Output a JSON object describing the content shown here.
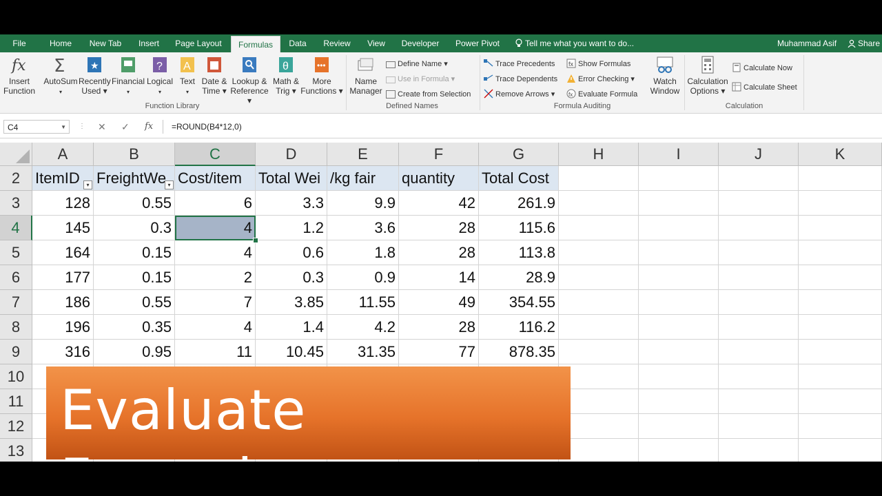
{
  "tabs": {
    "file": "File",
    "home": "Home",
    "new_tab": "New Tab",
    "insert": "Insert",
    "page_layout": "Page Layout",
    "formulas": "Formulas",
    "data": "Data",
    "review": "Review",
    "view": "View",
    "developer": "Developer",
    "power_pivot": "Power Pivot"
  },
  "tell_me": "Tell me what you want to do...",
  "user_name": "Muhammad Asif",
  "share": "Share",
  "ribbon": {
    "function_library": {
      "insert_function": [
        "Insert",
        "Function"
      ],
      "autosum": "AutoSum",
      "recently_used": [
        "Recently",
        "Used"
      ],
      "financial": "Financial",
      "logical": "Logical",
      "text": "Text",
      "date_time": [
        "Date &",
        "Time"
      ],
      "lookup": [
        "Lookup &",
        "Reference"
      ],
      "math": [
        "Math &",
        "Trig"
      ],
      "more": [
        "More",
        "Functions"
      ],
      "label": "Function Library"
    },
    "defined_names": {
      "name_manager": [
        "Name",
        "Manager"
      ],
      "define_name": "Define Name",
      "use_in_formula": "Use in Formula",
      "create_from_selection": "Create from Selection",
      "label": "Defined Names"
    },
    "formula_auditing": {
      "trace_precedents": "Trace Precedents",
      "trace_dependents": "Trace Dependents",
      "remove_arrows": "Remove Arrows",
      "show_formulas": "Show Formulas",
      "error_checking": "Error Checking",
      "evaluate_formula": "Evaluate Formula",
      "watch_window": [
        "Watch",
        "Window"
      ],
      "label": "Formula Auditing"
    },
    "calculation": {
      "calculation_options": [
        "Calculation",
        "Options"
      ],
      "calculate_now": "Calculate Now",
      "calculate_sheet": "Calculate Sheet",
      "label": "Calculation"
    }
  },
  "formula_bar": {
    "name_box": "C4",
    "formula": "=ROUND(B4*12,0)"
  },
  "columns": [
    "A",
    "B",
    "C",
    "D",
    "E",
    "F",
    "G",
    "H",
    "I",
    "J",
    "K"
  ],
  "rows": [
    "2",
    "3",
    "4",
    "5",
    "6",
    "7",
    "8",
    "9",
    "10",
    "11",
    "12",
    "13"
  ],
  "header_row": [
    "ItemID",
    "FreightWe",
    "Cost/item",
    "Total Wei",
    "/kg fair",
    "quantity",
    "Total Cost"
  ],
  "data_rows": [
    [
      "128",
      "0.55",
      "6",
      "3.3",
      "9.9",
      "42",
      "261.9"
    ],
    [
      "145",
      "0.3",
      "4",
      "1.2",
      "3.6",
      "28",
      "115.6"
    ],
    [
      "164",
      "0.15",
      "4",
      "0.6",
      "1.8",
      "28",
      "113.8"
    ],
    [
      "177",
      "0.15",
      "2",
      "0.3",
      "0.9",
      "14",
      "28.9"
    ],
    [
      "186",
      "0.55",
      "7",
      "3.85",
      "11.55",
      "49",
      "354.55"
    ],
    [
      "196",
      "0.35",
      "4",
      "1.4",
      "4.2",
      "28",
      "116.2"
    ],
    [
      "316",
      "0.95",
      "11",
      "10.45",
      "31.35",
      "77",
      "878.35"
    ]
  ],
  "active_cell": "C4",
  "banner_text": "Evaluate Formulas",
  "colors": {
    "ribbon_green": "#217346",
    "header_fill": "#dce6f1",
    "banner_orange": "#e6732a",
    "selected_cell": "#a6b4c8"
  }
}
